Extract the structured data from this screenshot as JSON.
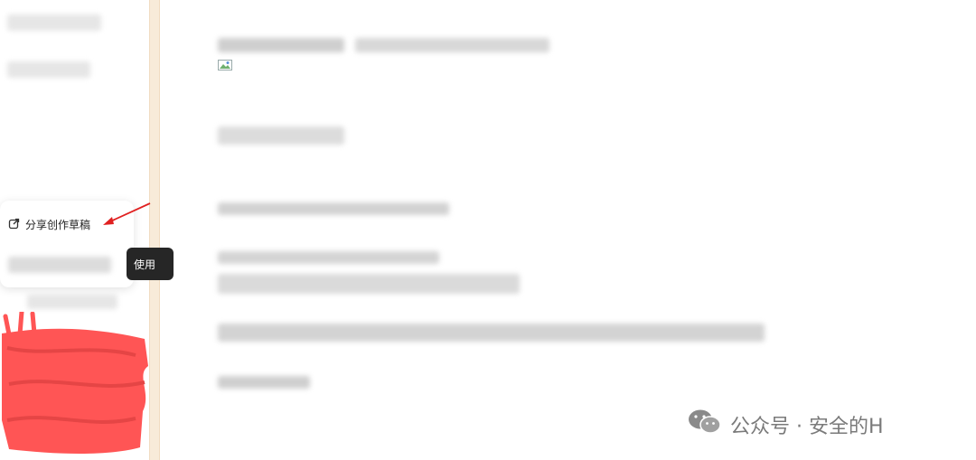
{
  "popup": {
    "share_draft_label": "分享创作草稿"
  },
  "tooltip": {
    "text": "使用"
  },
  "watermark": {
    "text": "公众号 · 安全的H"
  },
  "colors": {
    "accent_red": "#ff5555",
    "sidebar_strip": "#f8ebd9",
    "tooltip_bg": "#262626"
  }
}
